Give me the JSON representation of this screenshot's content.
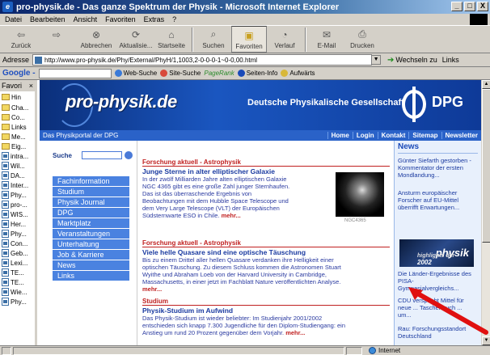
{
  "window": {
    "title": "pro-physik.de - Das ganze Spektrum der Physik - Microsoft Internet Explorer",
    "buttons": [
      "_",
      "□",
      "X"
    ]
  },
  "menu": [
    "Datei",
    "Bearbeiten",
    "Ansicht",
    "Favoriten",
    "Extras",
    "?"
  ],
  "toolbar": {
    "buttons": [
      {
        "label": "Zurück",
        "icon": "back-arrow-icon"
      },
      {
        "label": "",
        "icon": "forward-arrow-icon"
      },
      {
        "label": "Abbrechen",
        "icon": "stop-icon"
      },
      {
        "label": "Aktualisie...",
        "icon": "refresh-icon"
      },
      {
        "label": "Startseite",
        "icon": "home-icon"
      },
      {
        "label": "Suchen",
        "icon": "search-icon"
      },
      {
        "label": "Favoriten",
        "icon": "favorites-folder-icon"
      },
      {
        "label": "Verlauf",
        "icon": "history-icon"
      },
      {
        "label": "E-Mail",
        "icon": "mail-icon"
      },
      {
        "label": "Drucken",
        "icon": "print-icon"
      }
    ]
  },
  "address": {
    "label": "Adresse",
    "url": "http://www.pro-physik.de/Phy/External/PhyH/1,1003,2-0-0-0-1~0-0,00.html",
    "go_label": "Wechseln zu",
    "links_label": "Links"
  },
  "google": {
    "logo": "Google -",
    "buttons": [
      "Web-Suche",
      "Site-Suche",
      "Seiten-Info",
      "Aufwärts"
    ],
    "pagerank": "PageRank"
  },
  "favorites": {
    "header": "Favori",
    "close": "×",
    "add_label": "Hin",
    "items": [
      {
        "label": "Cha...",
        "type": "folder"
      },
      {
        "label": "Co...",
        "type": "folder"
      },
      {
        "label": "Links",
        "type": "folder"
      },
      {
        "label": "Me...",
        "type": "folder"
      },
      {
        "label": "Eig...",
        "type": "folder"
      },
      {
        "label": "intra...",
        "type": "page"
      },
      {
        "label": "Wil...",
        "type": "page"
      },
      {
        "label": "DA...",
        "type": "page"
      },
      {
        "label": "Inter...",
        "type": "page"
      },
      {
        "label": "Phy...",
        "type": "page"
      },
      {
        "label": "pro-...",
        "type": "page"
      },
      {
        "label": "WIS...",
        "type": "page"
      },
      {
        "label": "Her...",
        "type": "page"
      },
      {
        "label": "Phy...",
        "type": "page"
      },
      {
        "label": "Con...",
        "type": "page"
      },
      {
        "label": "Geb...",
        "type": "page"
      },
      {
        "label": "Lexi...",
        "type": "page"
      },
      {
        "label": "TE...",
        "type": "page"
      },
      {
        "label": "TE...",
        "type": "page"
      },
      {
        "label": "Wie...",
        "type": "page"
      },
      {
        "label": "Phy...",
        "type": "page"
      }
    ]
  },
  "site": {
    "logo": "pro-physik.de",
    "dpg_text": "Deutsche Physikalische Gesellschaft",
    "dpg_abbr": "DPG",
    "portal_label": "Das Physikportal der DPG",
    "top_links": [
      "Home",
      "Login",
      "Kontakt",
      "Sitemap",
      "Newsletter"
    ],
    "search_label": "Suche",
    "nav": [
      "Fachinformation",
      "Studium",
      "Physik Journal",
      "DPG",
      "Marktplatz",
      "Veranstaltungen",
      "Unterhaltung",
      "Job & Karriere",
      "News",
      "Links"
    ]
  },
  "articles": [
    {
      "section": "Forschung aktuell - Astrophysik",
      "title": "Junge Sterne in alter elliptischer Galaxie",
      "lines": [
        "In der zwölf Milliarden Jahre alten elliptischen Galaxie",
        "NGC 4365 gibt es eine große Zahl junger Sternhaufen.",
        "Das ist das überraschende Ergebnis von",
        "Beobachtungen mit dem Hubble Space Telescope und",
        "dem Very Large Telescope (VLT) der Europäischen",
        "Südsternwarte ESO in Chile."
      ],
      "more": "mehr...",
      "image_caption": "NGC4365"
    },
    {
      "section": "Forschung aktuell - Astrophysik",
      "title": "Viele helle Quasare sind eine optische Täuschung",
      "lines": [
        "Bis zu einem Drittel aller hellen Quasare verdanken ihre Helligkeit einer",
        "optischen Täuschung. Zu diesem Schluss kommen die Astronomen Stuart",
        "Wyithe und Abraham Loeb von der Harvard University in Cambridge,",
        "Massachusetts, in einer jetzt im Fachblatt Nature veröffentlichten Analyse."
      ],
      "more": "mehr..."
    },
    {
      "section": "Studium",
      "title": "Physik-Studium im Aufwind",
      "lines": [
        "Das Physik-Studium ist wieder beliebter: Im Studienjahr 2001/2002",
        "entschieden sich knapp 7.300 Jugendliche für den Diplom-Studiengang: ein",
        "Anstieg um rund 20 Prozent gegenüber dem Vorjahr."
      ],
      "more": "mehr..."
    }
  ],
  "news": {
    "header": "News",
    "items": [
      "Günter Siefarth gestorben - Kommentator der ersten Mondlandung...",
      "Ansturm europäischer Forscher auf EU-Mittel überrifft Erwartungen...",
      "Die Länder-Ergebnisse des PISA-Gymnasialvergleichs...",
      "CDU verspricht Mittel für neue ... Taschenbuch ... um...",
      "Rau: Forschungsstandort Deutschland"
    ],
    "image_year": "2002",
    "image_caption": "highlights der",
    "image_word": "physik"
  },
  "status": {
    "zone": "Internet"
  },
  "colors": {
    "title_bar": "#0a246a",
    "banner": "#1a56c0",
    "nav_item": "#4a82e0",
    "section_red": "#c02020",
    "link_blue": "#1a3aa0",
    "arrow_red": "#e01010"
  }
}
